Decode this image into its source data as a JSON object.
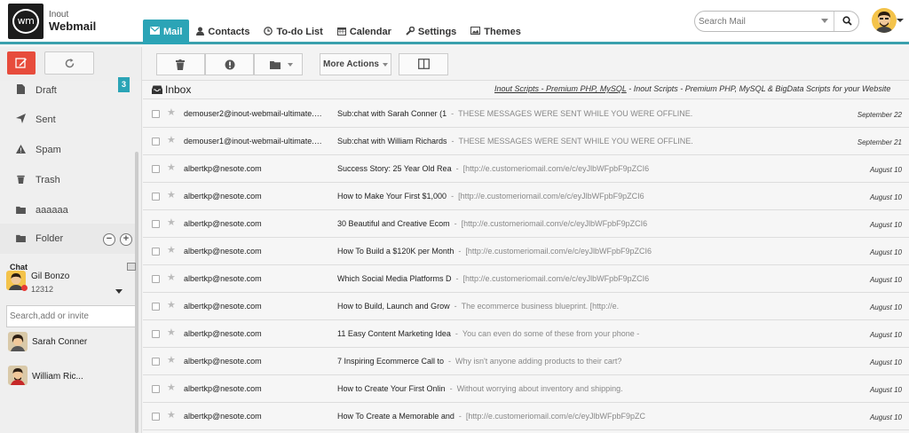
{
  "brand": {
    "logo_mark": "wm",
    "line1": "Inout",
    "line2": "Webmail"
  },
  "nav": [
    {
      "label": "Mail",
      "icon": "envelope-icon",
      "active": true
    },
    {
      "label": "Contacts",
      "icon": "user-icon"
    },
    {
      "label": "To-do List",
      "icon": "clock-icon"
    },
    {
      "label": "Calendar",
      "icon": "calendar-icon"
    },
    {
      "label": "Settings",
      "icon": "wrench-icon"
    },
    {
      "label": "Themes",
      "icon": "image-icon"
    }
  ],
  "search": {
    "placeholder": "Search Mail"
  },
  "toolbar": {
    "more_actions": "More Actions"
  },
  "folders": [
    {
      "label": "Draft",
      "icon": "file-icon",
      "count": "3"
    },
    {
      "label": "Sent",
      "icon": "send-icon"
    },
    {
      "label": "Spam",
      "icon": "warning-icon"
    },
    {
      "label": "Trash",
      "icon": "trash-icon"
    },
    {
      "label": "aaaaaa",
      "icon": "folder-icon"
    },
    {
      "label": "Folder",
      "icon": "folder-icon"
    }
  ],
  "chat": {
    "title": "Chat",
    "me_name": "Gil Bonzo",
    "me_status": "12312",
    "input_placeholder": "Search,add or invite",
    "contacts": [
      "Sarah Conner",
      "William Ric..."
    ]
  },
  "inbox": {
    "title": "Inbox",
    "ad_link": "Inout Scripts - Premium PHP, MySQL",
    "ad_text": " - Inout Scripts - Premium PHP, MySQL & BigData Scripts for your Website"
  },
  "emails": [
    {
      "from": "demouser2@inout-webmail-ultimate.com",
      "subject": "Sub:chat with Sarah Conner (1",
      "preview": "THESE MESSAGES WERE SENT WHILE YOU WERE OFFLINE.",
      "date": "September 22"
    },
    {
      "from": "demouser1@inout-webmail-ultimate.com",
      "subject": "Sub:chat with William Richards",
      "preview": "THESE MESSAGES WERE SENT WHILE YOU WERE OFFLINE.",
      "date": "September 21"
    },
    {
      "from": "albertkp@nesote.com",
      "subject": "Success Story: 25 Year Old Rea",
      "preview": "[http://e.customeriomail.com/e/c/eyJlbWFpbF9pZCI6",
      "date": "August 10"
    },
    {
      "from": "albertkp@nesote.com",
      "subject": "How to Make Your First $1,000",
      "preview": "[http://e.customeriomail.com/e/c/eyJlbWFpbF9pZCI6",
      "date": "August 10"
    },
    {
      "from": "albertkp@nesote.com",
      "subject": "30 Beautiful and Creative Ecom",
      "preview": "[http://e.customeriomail.com/e/c/eyJlbWFpbF9pZCI6",
      "date": "August 10"
    },
    {
      "from": "albertkp@nesote.com",
      "subject": "How To Build a $120K per Month",
      "preview": "[http://e.customeriomail.com/e/c/eyJlbWFpbF9pZCI6",
      "date": "August 10"
    },
    {
      "from": "albertkp@nesote.com",
      "subject": "Which Social Media Platforms D",
      "preview": "[http://e.customeriomail.com/e/c/eyJlbWFpbF9pZCI6",
      "date": "August 10"
    },
    {
      "from": "albertkp@nesote.com",
      "subject": "How to Build, Launch and Grow",
      "preview": "The ecommerce business blueprint. [http://e.",
      "date": "August 10"
    },
    {
      "from": "albertkp@nesote.com",
      "subject": "11 Easy Content Marketing Idea",
      "preview": "You can even do some of these from your phone -",
      "date": "August 10"
    },
    {
      "from": "albertkp@nesote.com",
      "subject": "7 Inspiring Ecommerce Call to",
      "preview": "Why isn't anyone adding products to their cart?",
      "date": "August 10"
    },
    {
      "from": "albertkp@nesote.com",
      "subject": "How to Create Your First Onlin",
      "preview": "Without worrying about inventory and shipping.",
      "date": "August 10"
    },
    {
      "from": "albertkp@nesote.com",
      "subject": "How To Create a Memorable and",
      "preview": "[http://e.customeriomail.com/e/c/eyJlbWFpbF9pZC",
      "date": "August 10"
    }
  ]
}
